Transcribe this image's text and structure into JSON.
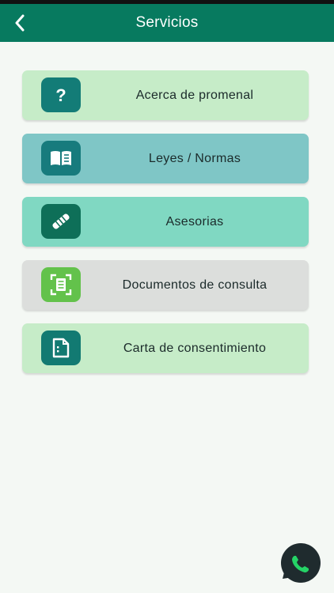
{
  "header": {
    "title": "Servicios"
  },
  "colors": {
    "header_bg": "#077a5f",
    "page_bg": "#f4f8f4"
  },
  "services": [
    {
      "label": "Acerca de promenal",
      "icon": "question-icon",
      "card_color": "#c6ecc8",
      "icon_color": "#137c77"
    },
    {
      "label": "Leyes / Normas",
      "icon": "book-icon",
      "card_color": "#7fc6c6",
      "icon_color": "#177b7d"
    },
    {
      "label": "Asesorias",
      "icon": "handshake-icon",
      "card_color": "#80d8c2",
      "icon_color": "#0e6f58"
    },
    {
      "label": "Documentos de consulta",
      "icon": "document-scan-icon",
      "card_color": "#dcdedc",
      "icon_color": "#63c24b"
    },
    {
      "label": "Carta de consentimiento",
      "icon": "file-icon",
      "card_color": "#c6ecc8",
      "icon_color": "#127a72"
    }
  ],
  "whatsapp": {
    "icon": "whatsapp-icon",
    "bubble_color": "#1f2b2e",
    "phone_color": "#25d366"
  }
}
